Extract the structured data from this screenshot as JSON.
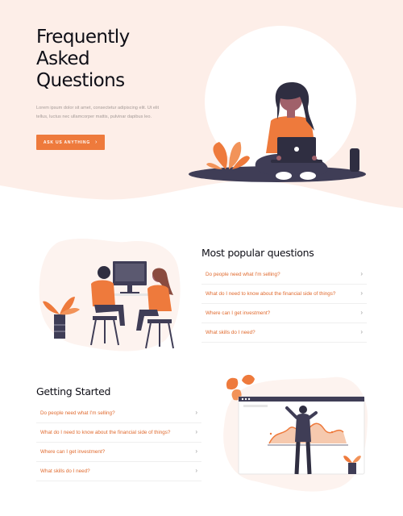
{
  "hero": {
    "title_lines": [
      "Frequently",
      "Asked",
      "Questions"
    ],
    "description_lines": [
      "Lorem ipsum dolor sit amet, consectetur adipiscing elit. Ut elit",
      "tellus, luctus nec ullamcorper mattis, pulvinar dapibus leo."
    ],
    "cta_label": "ASK US ANYTHING",
    "cta_chevron": "›"
  },
  "popular": {
    "heading": "Most popular questions",
    "items": [
      {
        "question": "Do people need what I'm selling?",
        "chevron": "›"
      },
      {
        "question": "What do I need to know about the financial side of things?",
        "chevron": "›"
      },
      {
        "question": "Where can I get investment?",
        "chevron": "›"
      },
      {
        "question": "What skills do I need?",
        "chevron": "›"
      }
    ]
  },
  "getting_started": {
    "heading": "Getting Started",
    "items": [
      {
        "question": "Do people need what I'm selling?",
        "chevron": "›"
      },
      {
        "question": "What do I need to know about the financial side of things?",
        "chevron": "›"
      },
      {
        "question": "Where can I get investment?",
        "chevron": "›"
      },
      {
        "question": "What skills do I need?",
        "chevron": "›"
      }
    ]
  },
  "colors": {
    "accent": "#ee7a3c",
    "hero_background": "#fdeee8",
    "question_text": "#e06a2e",
    "heading_text": "#0e0e16"
  },
  "icons": {
    "cta": "chevron-right-icon",
    "faq_items": "chevron-right-icon"
  }
}
